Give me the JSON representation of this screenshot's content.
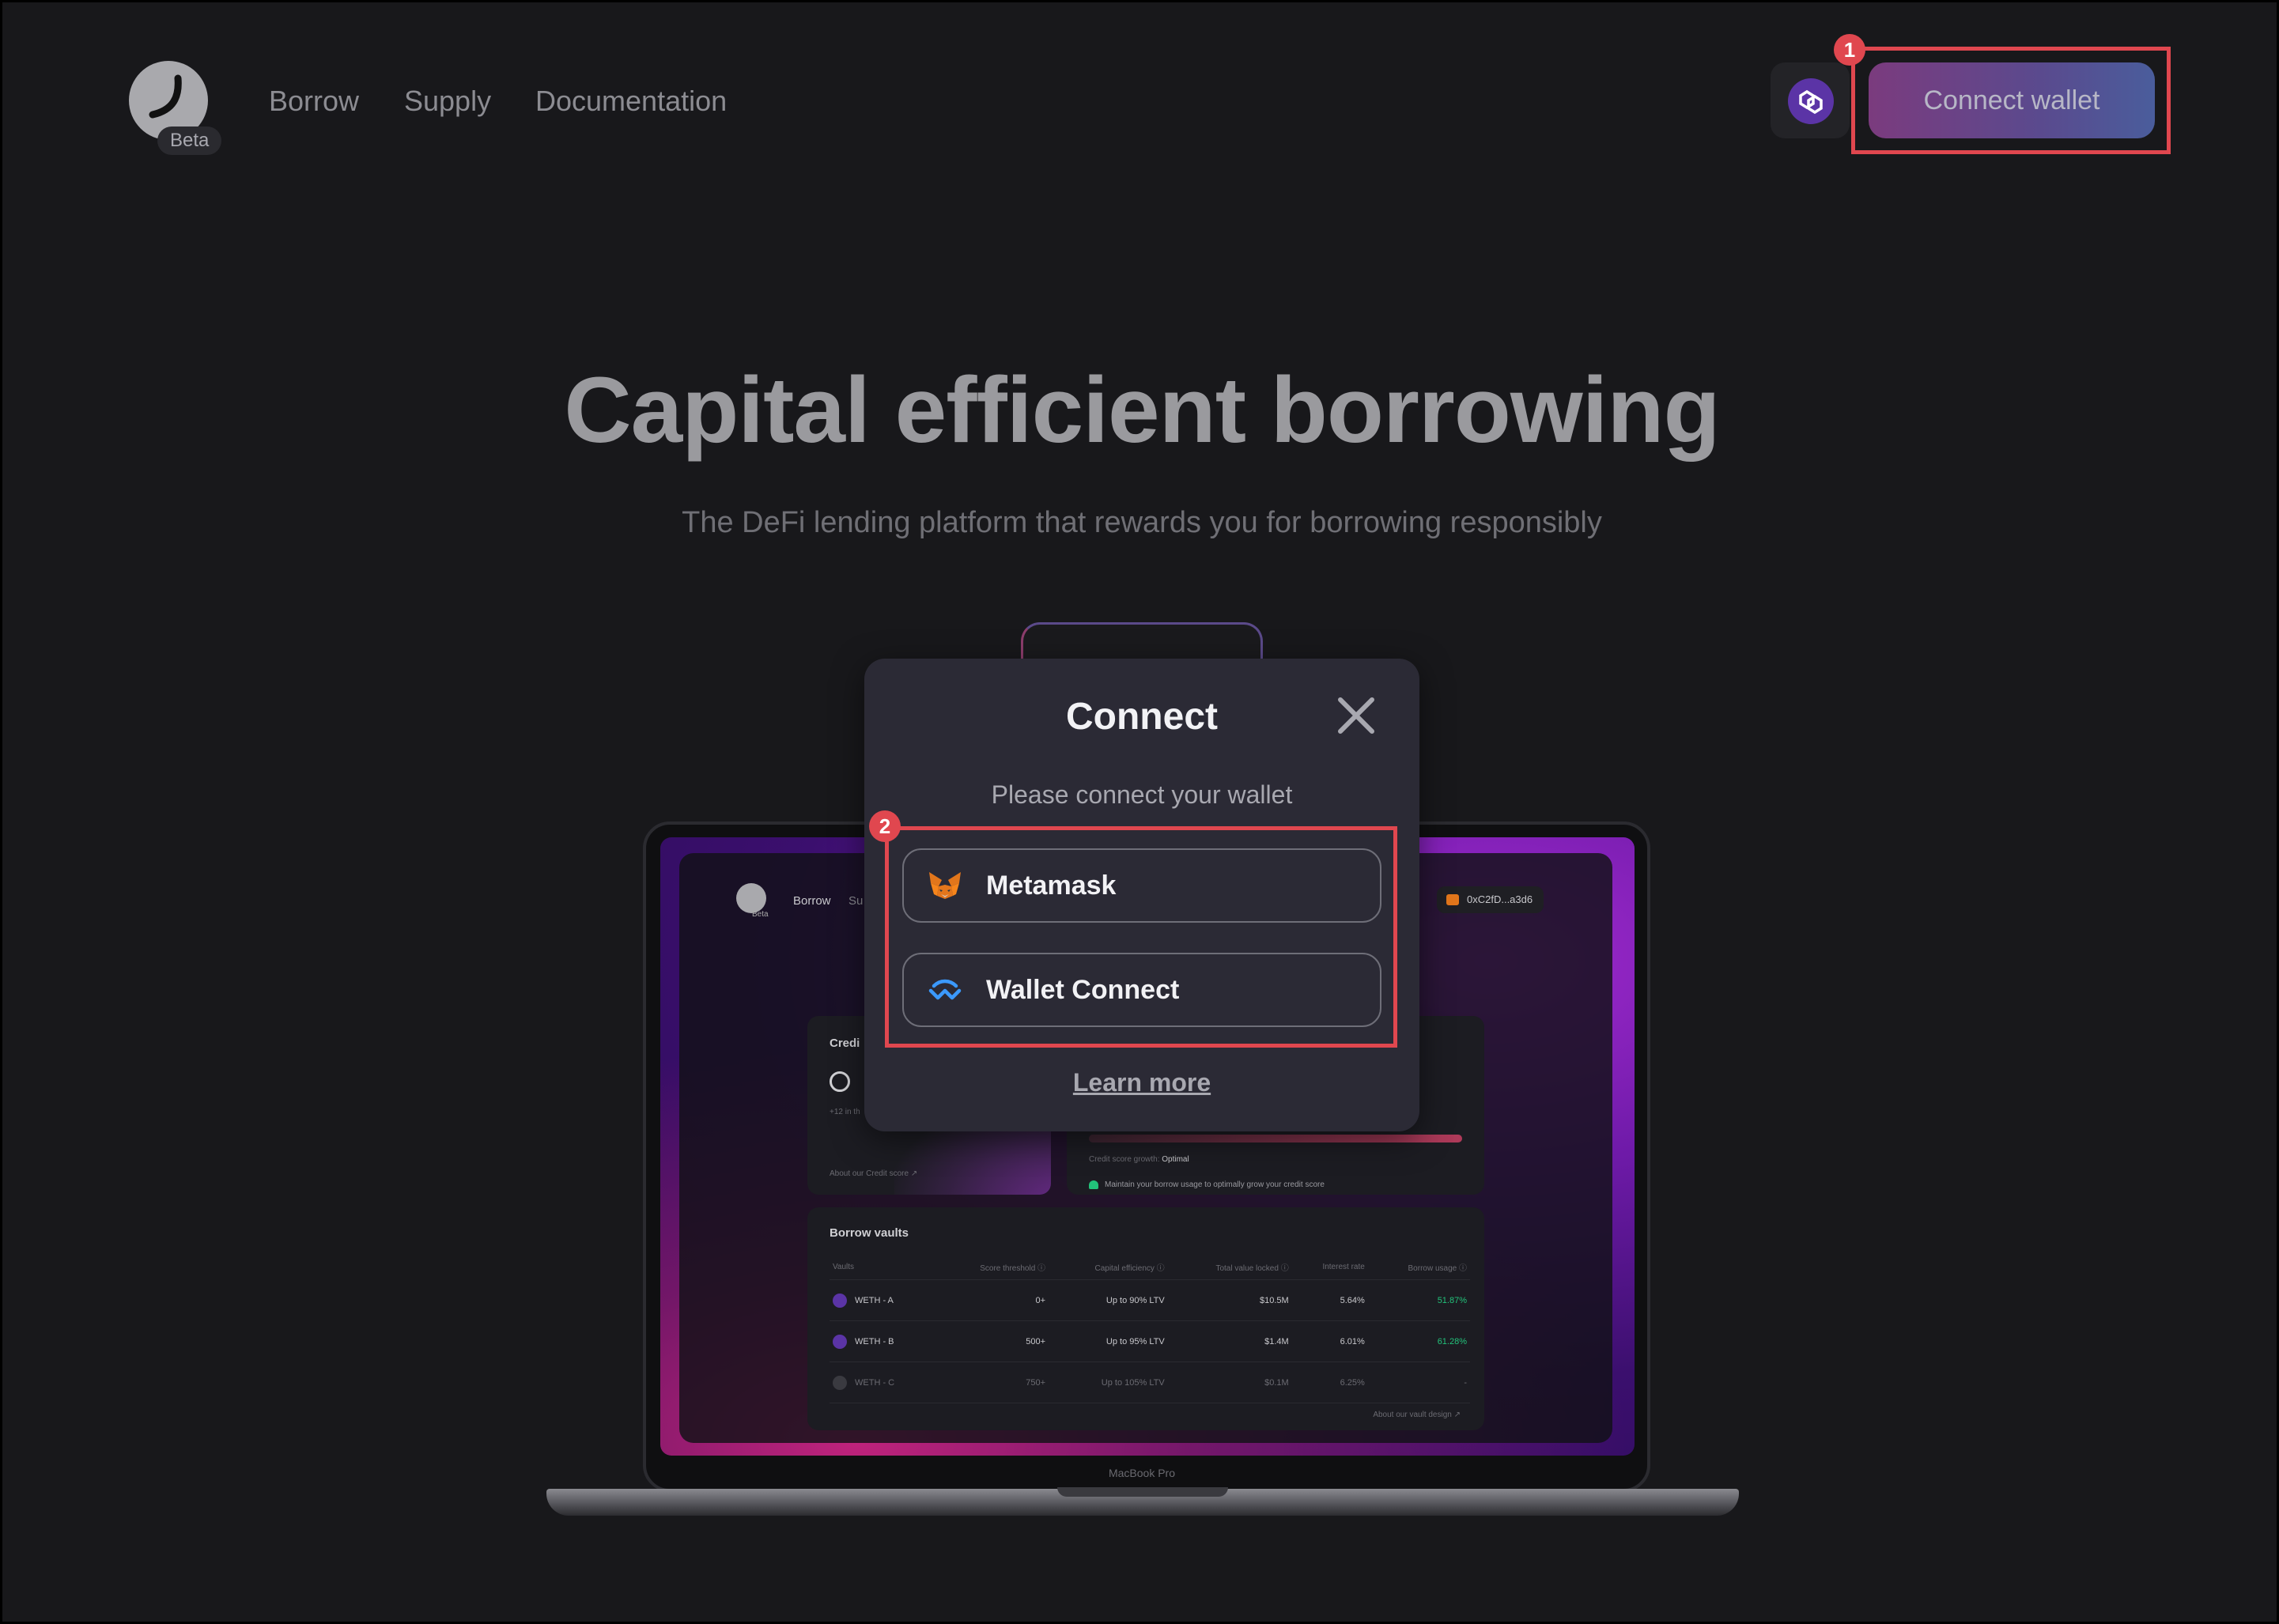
{
  "header": {
    "logo_badge": "Beta",
    "nav": [
      "Borrow",
      "Supply",
      "Documentation"
    ],
    "chain_icon": "polygon-icon",
    "connect_button": "Connect wallet"
  },
  "annotations": {
    "badge1": "1",
    "badge2": "2"
  },
  "hero": {
    "title": "Capital efficient borrowing",
    "subtitle": "The DeFi lending platform that rewards you for borrowing responsibly"
  },
  "laptop": {
    "label": "MacBook Pro",
    "app": {
      "beta": "Beta",
      "nav": [
        "Borrow",
        "Su"
      ],
      "wallet_address": "0xC2fD...a3d6",
      "credit_title": "Credi",
      "credit_sub": "+12 in th",
      "credit_link": "About our Credit score ↗",
      "growth_label": "Credit score growth:",
      "growth_value": "Optimal",
      "growth_hint": "Maintain your borrow usage to optimally grow your credit score",
      "vaults_title": "Borrow vaults",
      "vault_headers": [
        "Vaults",
        "Score threshold ⓘ",
        "Capital efficiency ⓘ",
        "Total value locked ⓘ",
        "Interest rate",
        "Borrow usage ⓘ"
      ],
      "vault_rows": [
        [
          "WETH - A",
          "0+",
          "Up to 90% LTV",
          "$10.5M",
          "5.64%",
          "51.87%"
        ],
        [
          "WETH - B",
          "500+",
          "Up to 95% LTV",
          "$1.4M",
          "6.01%",
          "61.28%"
        ],
        [
          "WETH - C",
          "750+",
          "Up to 105% LTV",
          "$0.1M",
          "6.25%",
          "-"
        ]
      ],
      "vaults_link": "About our vault design ↗"
    }
  },
  "modal": {
    "title": "Connect",
    "subtitle": "Please connect your wallet",
    "options": [
      {
        "label": "Metamask",
        "icon": "metamask-fox-icon"
      },
      {
        "label": "Wallet Connect",
        "icon": "walletconnect-icon"
      }
    ],
    "learn_more": "Learn more"
  },
  "colors": {
    "background": "#18181b",
    "modal": "#2b2a35",
    "annotation": "#e0474f",
    "connect_gradient_start": "#7b3b7e",
    "connect_gradient_end": "#4a5d9c"
  }
}
